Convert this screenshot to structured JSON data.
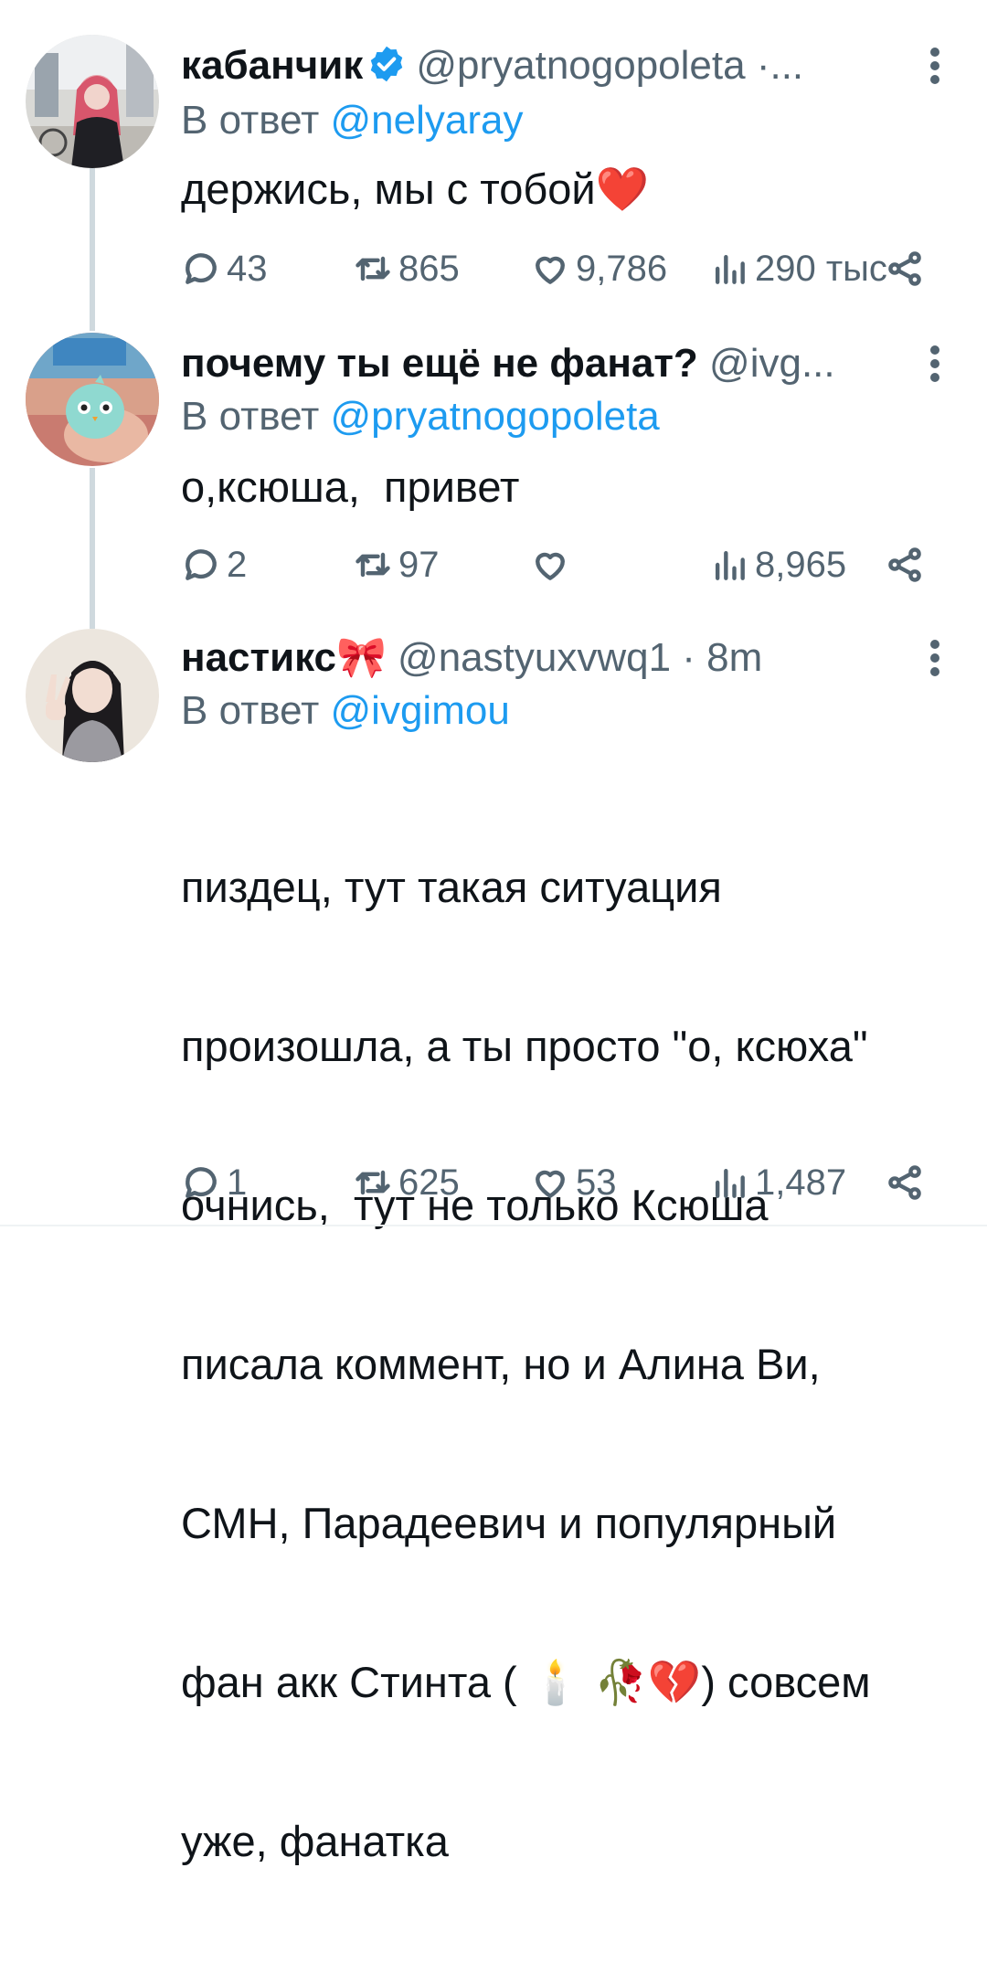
{
  "tweets": [
    {
      "name": "кабанчик",
      "verified": true,
      "handle": "@pryatnogopoleta ·...",
      "reply_prefix": "В ответ",
      "reply_to": "@nelyaray",
      "text": "держись, мы с тобой❤️",
      "replies": "43",
      "retweets": "865",
      "likes": "9,786",
      "views": "290 тыс"
    },
    {
      "name": "почему ты ещё не фанат?",
      "verified": false,
      "handle": "@ivg...",
      "reply_prefix": "В ответ",
      "reply_to": "@pryatnogopoleta",
      "text": "о,ксюша,  привет",
      "replies": "2",
      "retweets": "97",
      "likes": "",
      "views": "8,965"
    },
    {
      "name": "настикс🎀",
      "verified": false,
      "handle": "@nastyuxvwq1 · 8m",
      "reply_prefix": "В ответ",
      "reply_to": "@ivgimou",
      "text_lines": [
        "пиздец, тут такая ситуация",
        "произошла, а ты просто \"о, ксюха\"",
        "очнись,  тут не только Ксюша",
        "писала коммент, но и Алина Ви,",
        "СМН, Парадеевич и популярный",
        "фан акк Стинта ( 🕯️ 🥀💔) совсем",
        "уже, фанатка"
      ],
      "replies": "1",
      "retweets": "625",
      "likes": "53",
      "views": "1,487"
    }
  ],
  "colors": {
    "link": "#1d9bf0",
    "secondary": "#536471",
    "thread_line": "#cfd9de",
    "verified": "#1d9bf0"
  },
  "icons": [
    "reply-icon",
    "retweet-icon",
    "like-icon",
    "views-icon",
    "share-icon",
    "more-icon",
    "verified-badge-icon"
  ]
}
